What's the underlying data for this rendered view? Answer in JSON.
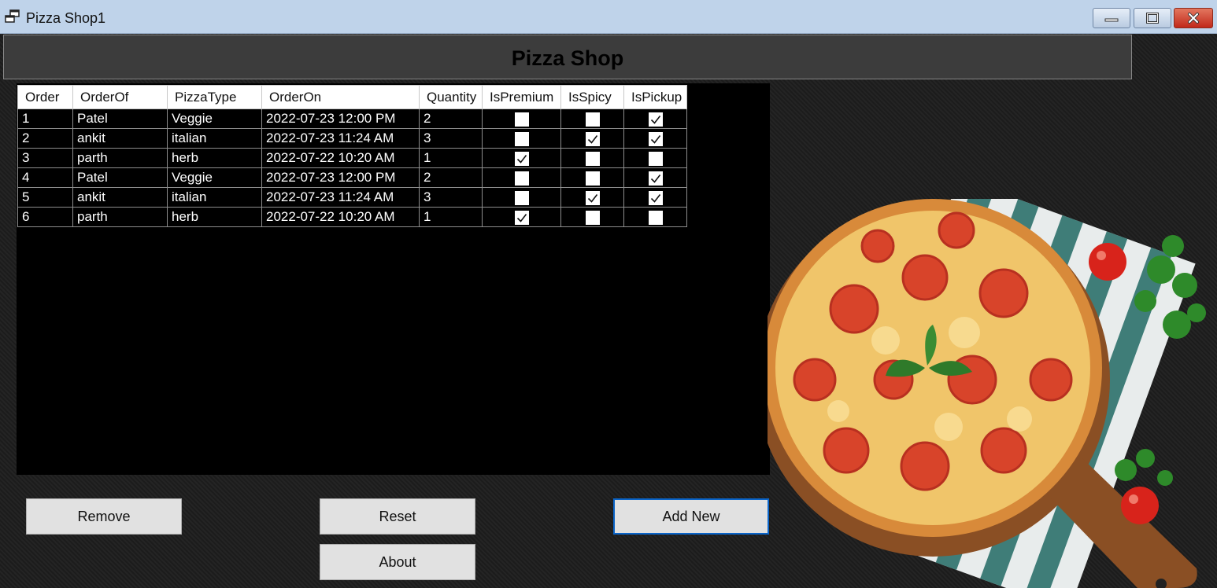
{
  "window": {
    "title": "Pizza Shop1"
  },
  "header": {
    "title": "Pizza Shop"
  },
  "grid": {
    "columns": [
      "Order",
      "OrderOf",
      "PizzaType",
      "OrderOn",
      "Quantity",
      "IsPremium",
      "IsSpicy",
      "IsPickup"
    ],
    "rows": [
      {
        "order": "1",
        "order_of": "Patel",
        "pizza_type": "Veggie",
        "order_on": "2022-07-23 12:00 PM",
        "quantity": "2",
        "is_premium": false,
        "is_spicy": false,
        "is_pickup": true
      },
      {
        "order": "2",
        "order_of": "ankit",
        "pizza_type": "italian",
        "order_on": "2022-07-23 11:24 AM",
        "quantity": "3",
        "is_premium": false,
        "is_spicy": true,
        "is_pickup": true
      },
      {
        "order": "3",
        "order_of": "parth",
        "pizza_type": "herb",
        "order_on": "2022-07-22 10:20 AM",
        "quantity": "1",
        "is_premium": true,
        "is_spicy": false,
        "is_pickup": false
      },
      {
        "order": "4",
        "order_of": "Patel",
        "pizza_type": "Veggie",
        "order_on": "2022-07-23 12:00 PM",
        "quantity": "2",
        "is_premium": false,
        "is_spicy": false,
        "is_pickup": true
      },
      {
        "order": "5",
        "order_of": "ankit",
        "pizza_type": "italian",
        "order_on": "2022-07-23 11:24 AM",
        "quantity": "3",
        "is_premium": false,
        "is_spicy": true,
        "is_pickup": true
      },
      {
        "order": "6",
        "order_of": "parth",
        "pizza_type": "herb",
        "order_on": "2022-07-22 10:20 AM",
        "quantity": "1",
        "is_premium": true,
        "is_spicy": false,
        "is_pickup": false
      }
    ]
  },
  "buttons": {
    "remove": "Remove",
    "reset": "Reset",
    "add_new": "Add New",
    "about": "About"
  },
  "colors": {
    "titlebar": "#bfd3ea",
    "close_button": "#c8382a",
    "header_panel": "#3c3c3c",
    "grid_background": "#000000",
    "default_button_border": "#0a64c8"
  },
  "icons": {
    "app": "window-app-icon",
    "minimize": "minimize-icon",
    "maximize": "maximize-icon",
    "close": "close-icon",
    "check": "checkmark-icon"
  }
}
